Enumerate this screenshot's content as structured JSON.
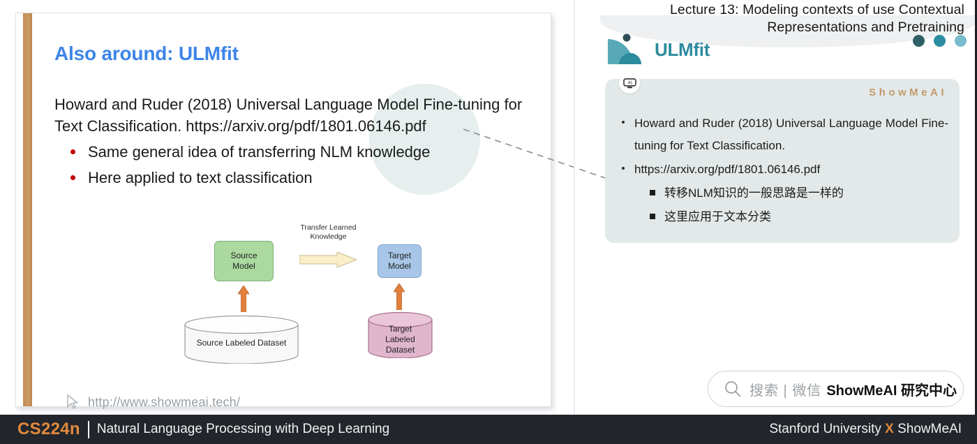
{
  "slide": {
    "title": "Also around: ULMfit",
    "body": "Howard and Ruder (2018) Universal Language Model Fine-tuning for Text Classification. https://arxiv.org/pdf/1801.06146.pdf",
    "bullets": [
      "Same general idea of transferring NLM knowledge",
      "Here applied to text classification"
    ],
    "footer_url": "http://www.showmeai.tech/",
    "footer_icon": "cursor-arrow-icon",
    "accent_color": "#c48d55",
    "title_color": "#3d85e8",
    "bullet_color": "#c00000"
  },
  "diagram": {
    "transfer_label": "Transfer Learned\nKnowledge",
    "transfer_label_line1": "Transfer Learned",
    "transfer_label_line2": "Knowledge",
    "source_model": "Source\nModel",
    "source_model_line1": "Source",
    "source_model_line2": "Model",
    "target_model": "Target\nModel",
    "target_model_line1": "Target",
    "target_model_line2": "Model",
    "source_dataset": "Source Labeled Dataset",
    "target_dataset_line1": "Target",
    "target_dataset_line2": "Labeled",
    "target_dataset_line3": "Dataset",
    "colors": {
      "source_model": "#abd9a0",
      "target_model": "#a8c7e8",
      "target_dataset": "#e0b6cc",
      "source_dataset": "#f7f7f7",
      "arrow_up": "#e2803c",
      "arrow_transfer": "#faeec8"
    }
  },
  "header": {
    "lecture_line1": "Lecture 13: Modeling contexts of use Contextual",
    "lecture_line2": "Representations and Pretraining",
    "logo_text": "ULMfit",
    "logo_icon": "ulmfit-logo-icon",
    "logo_color": "#2d8b9e",
    "dots": [
      "#2f6068",
      "#2b8ba1",
      "#79bccd"
    ]
  },
  "panel": {
    "ai_icon": "ai-robot-icon",
    "brand": "ShowMeAI",
    "brand_color": "#c19a6b",
    "items": [
      {
        "marker": "dot",
        "text": "Howard and Ruder (2018) Universal Language Model Fine-tuning for Text Classification."
      },
      {
        "marker": "dot",
        "text": "https://arxiv.org/pdf/1801.06146.pdf"
      },
      {
        "marker": "square",
        "text": "转移NLM知识的一般思路是一样的"
      },
      {
        "marker": "square",
        "text": "这里应用于文本分类"
      }
    ]
  },
  "search": {
    "icon": "search-icon",
    "gray_text": "搜索 | 微信",
    "bold_text": "ShowMeAI 研究中心"
  },
  "bottom_bar": {
    "course_code": "CS224n",
    "course_name": "Natural Language Processing with Deep Learning",
    "right_left": "Stanford University",
    "right_x": "X",
    "right_right": "ShowMeAI",
    "accent_color": "#e08a3c",
    "background": "#22262c"
  }
}
